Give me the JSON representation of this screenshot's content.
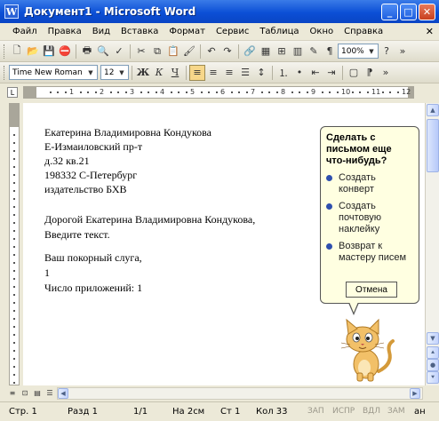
{
  "window": {
    "title": "Документ1 - Microsoft Word",
    "min": "_",
    "max": "□",
    "close": "✕"
  },
  "menu": [
    "Файл",
    "Правка",
    "Вид",
    "Вставка",
    "Формат",
    "Сервис",
    "Таблица",
    "Окно",
    "Справка"
  ],
  "menu_close": "✕",
  "toolbar": {
    "zoom": "100%",
    "font_name": "Time New Roman",
    "font_size": "12",
    "bold": "Ж",
    "italic": "К",
    "underline": "Ч"
  },
  "ruler": {
    "corner": "L",
    "labels": [
      "1",
      "2",
      "3",
      "4",
      "5",
      "6",
      "7",
      "8",
      "9",
      "10",
      "11",
      "12"
    ]
  },
  "document": {
    "lines": [
      "Екатерина Владимировна Кондукова",
      "Е-Измаиловский пр-т",
      "д.32 кв.21",
      "198332 С-Петербург",
      "издательство БХВ",
      "Дорогой Екатерина Владимировна Кондукова,",
      "Введите текст.",
      "Ваш покорный слуга,",
      "1",
      "Число приложений: 1"
    ]
  },
  "assistant": {
    "title": "Сделать с письмом еще что-нибудь?",
    "options": [
      "Создать конверт",
      "Создать почтовую наклейку",
      "Возврат к мастеру писем"
    ],
    "cancel": "Отмена",
    "icon": "office-cat"
  },
  "status": {
    "page": "Стр. 1",
    "section": "Разд 1",
    "pages": "1/1",
    "at": "На 2см",
    "line": "Ст 1",
    "col": "Кол 33",
    "rec": "ЗАП",
    "trk": "ИСПР",
    "ext": "ВДЛ",
    "ovr": "ЗАМ",
    "lang": "ан"
  },
  "colors": {
    "titlebar": "#0b4fd6",
    "balloon": "#ffffe1",
    "bullet": "#2e4fae"
  }
}
